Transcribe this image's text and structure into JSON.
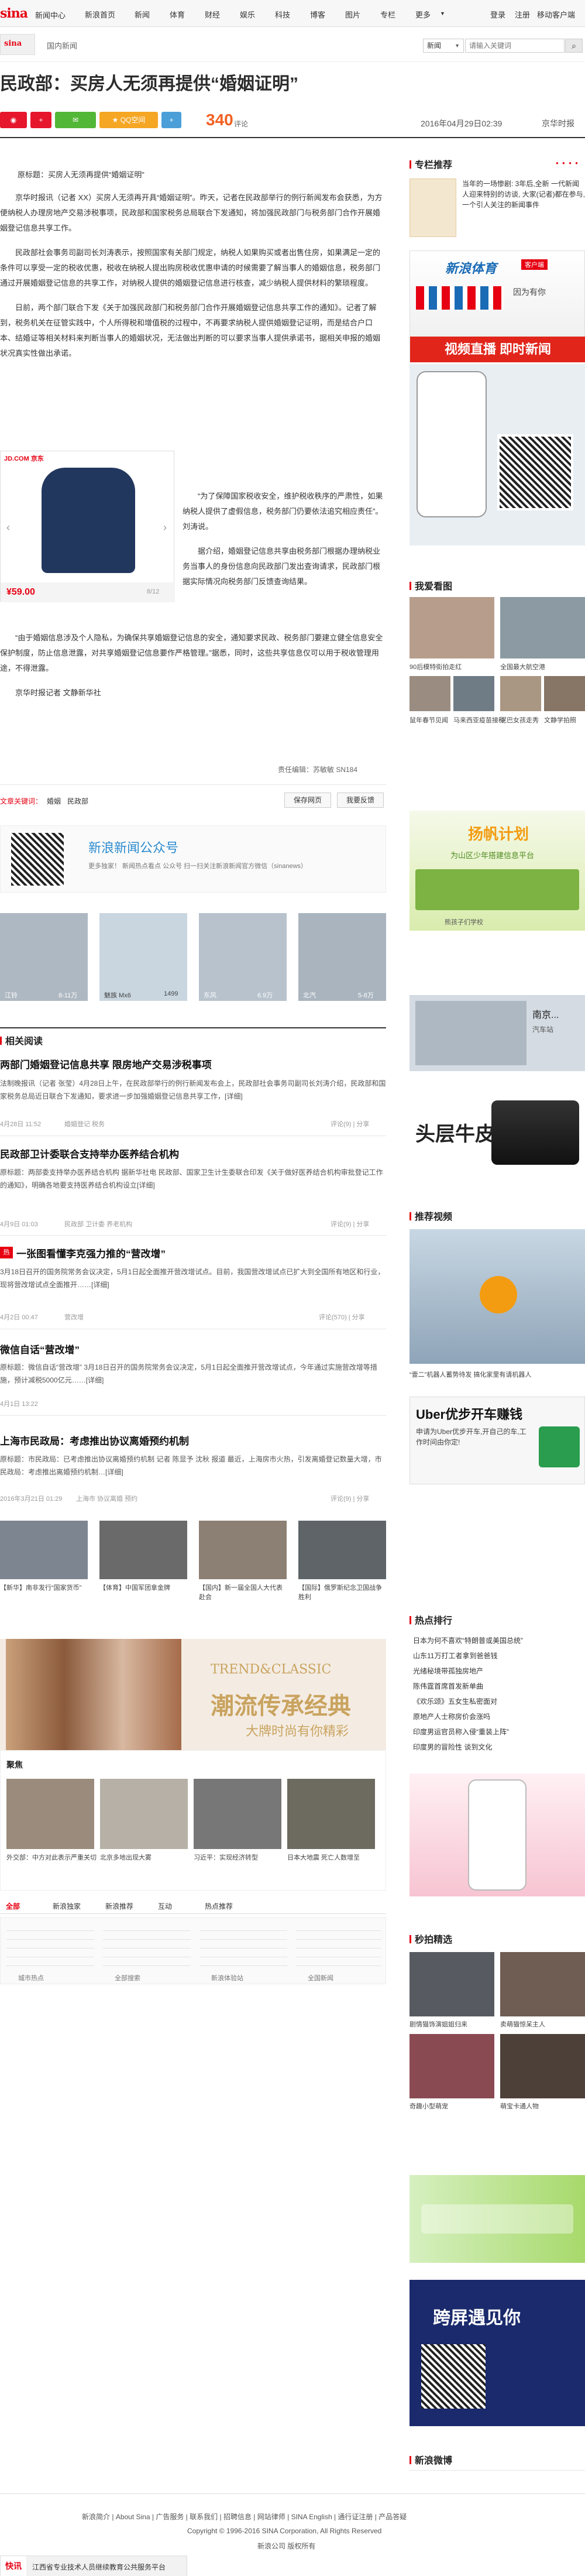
{
  "topnav": {
    "logo": "sina",
    "center": "新闻中心",
    "items": [
      "新浪首页",
      "新闻",
      "体育",
      "财经",
      "娱乐",
      "科技",
      "博客",
      "图片",
      "专栏",
      "更多"
    ],
    "login": "登录",
    "register": "注册",
    "mobile": "移动客户端"
  },
  "subnav": {
    "crumb": "国内新闻",
    "search_select": "新闻",
    "search_placeholder": "请输入关键词"
  },
  "article": {
    "title": "民政部：买房人无须再提供“婚姻证明”",
    "comments_count": "340",
    "comments_label": "评论",
    "datetime": "2016年04月29日02:39",
    "source": "京华时报",
    "share_weibo": "",
    "share_weixin": "",
    "share_qzone": "QQ空间",
    "orig_title": "原标题：买房人无须再提供“婚姻证明”",
    "paragraphs": [
      "京华时报讯（记者 XX）买房人无须再开具“婚姻证明”。昨天，记者在民政部举行的例行新闻发布会获悉，为方便纳税人办理房地产交易涉税事项，民政部和国家税务总局联合下发通知，将加强民政部门与税务部门合作开展婚姻登记信息共享工作。",
      "民政部社会事务司副司长刘涛表示，按照国家有关部门规定，纳税人如果购买或者出售住房，如果满足一定的条件可以享受一定的税收优惠，税收在纳税人提出购房税收优惠申请的时候需要了解当事人的婚姻信息，税务部门通过开展婚姻登记信息的共享工作，对纳税人提供的婚姻登记信息进行核查，减少纳税人提供材料的繁琐程度。",
      "日前，两个部门联合下发《关于加强民政部门和税务部门合作开展婚姻登记信息共享工作的通知》。记者了解到，税务机关在征管实践中，个人所得税和增值税的过程中，不再要求纳税人提供婚姻登记证明，而是结合户口本、结婚证等相关材料来判断当事人的婚姻状况，无法做出判断的可以要求当事人提供承诺书，据相关申报的婚姻状况真实性做出承诺。",
      "“为了保障国家税收安全，维护税收秩序的严肃性，如果纳税人提供了虚假信息，税务部门仍要依法追究相应责任”。刘涛说。",
      "据介绍，婚姻登记信息共享由税务部门根据办理纳税业务当事人的身份信息向民政部门发出查询请求，民政部门根据实际情况向税务部门反馈查询结果。",
      "“由于婚姻信息涉及个人隐私，为确保共享婚姻登记信息的安全，通知要求民政、税务部门要建立健全信息安全保护制度，防止信息泄露，对共享婚姻登记信息要作严格管理。”据悉，同时，这些共享信息仅可以用于税收管理用途，不得泄露。",
      "京华时报记者 文静新华社"
    ],
    "editor": "责任编辑：苏敏敏 SN184",
    "keywords_label": "文章关键词：",
    "keywords": [
      "婚姻",
      "民政部"
    ],
    "btn_save": "保存网页",
    "btn_report": "我要反馈"
  },
  "ad_shirt": {
    "brand": "JD.COM 京东",
    "price": "¥59.00",
    "page": "8/12"
  },
  "wechat": {
    "title": "新浪新闻公众号",
    "desc": "更多独家！ 新闻热点看点 公众号 扫一扫关注新浪新闻官方微信（sinanews）"
  },
  "cars": [
    {
      "label": "江铃",
      "price": "8-11万"
    },
    {
      "label": "魅族 Mx6",
      "price": "1499"
    },
    {
      "label": "东风",
      "price": "6.9万"
    },
    {
      "label": "北汽",
      "price": "5-8万"
    }
  ],
  "related": {
    "title": "相关阅读",
    "items": [
      {
        "title": "两部门婚姻登记信息共享 限房地产交易涉税事项",
        "text": "法制晚报讯（记者 张莹）4月28日上午，在民政部举行的例行新闻发布会上，民政部社会事务司副司长刘涛介绍，民政部和国家税务总局近日联合下发通知，要求进一步加强婚姻登记信息共享工作，[详细]",
        "date": "4月28日 11:52",
        "tags": "婚姻登记 税务",
        "ops": "评论(9) | 分享"
      },
      {
        "title": "民政部卫计委联合支持举办医养结合机构",
        "text": "原标题：两部委支持举办医养结合机构 据新华社电 民政部、国家卫生计生委联合印发《关于做好医养结合机构审批登记工作的通知》，明确各地要支持医养结合机构设立[详细]",
        "date": "4月9日 01:03",
        "tags": "民政部 卫计委 养老机构",
        "ops": "评论(9) | 分享"
      },
      {
        "title": "一张图看懂李克强力推的“营改增”",
        "text": "3月18日召开的国务院常务会议决定，5月1日起全面推开营改增试点。目前，我国营改增试点已扩大到全国所有地区和行业，现将营改增试点全面推开……[详细]",
        "date": "4月2日 00:47",
        "tags": "营改增",
        "ops": "评论(570) | 分享"
      },
      {
        "title": "微信自话“营改增”",
        "text": "原标题：微信自话“营改增” 3月18日召开的国务院常务会议决定，5月1日起全面推开营改增试点，今年通过实施营改增等措施，预计减税5000亿元……[详细]",
        "date": "4月1日 13:22",
        "tags": "",
        "ops": ""
      },
      {
        "title": "上海市民政局：考虑推出协议离婚预约机制",
        "text": "原标题：市民政局：已考虑推出协议离婚预约机制 记者 陈显予 沈秋 报道 最近，上海房市火热，引发离婚登记数量大增，市民政局：考虑推出离婚预约机制…[详细]",
        "date": "2016年3月21日 01:29",
        "tags": "上海市 协议离婚 预约",
        "ops": "评论(9) | 分享"
      }
    ]
  },
  "photos": [
    {
      "label": "【新华】南非发行“国家货币”",
      "img": "photo"
    },
    {
      "label": "【体育】中国军团拿金牌",
      "img": "photo"
    },
    {
      "label": "【国内】新一届全国人大代表赴会",
      "img": "photo"
    },
    {
      "label": "【国际】俄罗斯纪念卫国战争胜利",
      "img": "photo"
    }
  ],
  "banner": {
    "top": "TREND&CLASSIC",
    "main": "潮流传承经典",
    "sub": "大牌时尚有你精彩"
  },
  "focus": {
    "title": "聚焦",
    "items": [
      "外交部：中方对此表示严重关切",
      "北京多地出现大雾",
      "习近平：实现经济转型",
      "日本大地震 死亡人数增至"
    ],
    "tabs": [
      "全部",
      "新浪独家",
      "新浪推荐",
      "互动",
      "热点推荐"
    ]
  },
  "links_grid": [
    "城市热点",
    "全部搜索",
    "新浪体验站",
    "全国新闻"
  ],
  "sidebar": {
    "hot_title": "专栏推荐",
    "hot_text": "当年的一场惨剧: 3年后,全新 一代新闻人迎来特别的访谈, 大家(记者)都在参与,一个引人关注的新闻事件",
    "sports_title": "新浪体育",
    "sports_sub": "客户端",
    "sports_slogan": "因为有你",
    "video_live": "视频直播 即时新闻",
    "watch_title": "我爱看图",
    "watch_items": [
      "90后模特街拍走红",
      "全国最大航空港",
      "鼠年春节见闻",
      "马来西亚疫苗接种",
      "泥巴女孩走秀",
      "文静学拍照"
    ],
    "plan_title": "扬帆计划",
    "plan_sub": "为山区少年搭建信息平台",
    "plan_note": "熊孩子们学校",
    "car_city": "南京...",
    "car_sub": "汽车站",
    "top3": "头层牛皮",
    "video_title": "推荐视频",
    "video_caption": "“壹二”机器人蓄势待发 搞化家里有请机器人",
    "uber_title": "Uber优步开车赚钱",
    "uber_sub": "申请为Uber优步开车,开自己的车,工作时间由你定!",
    "hot2_title": "热点排行",
    "hot2_items": [
      "日本为何不喜欢“特朗普或美国总统”",
      "山东11万打工者拿到爸爸钱",
      "光绪秘境带孤独房地产",
      "陈伟霆首席首发新单曲",
      "《欢乐颂》五女生私密面对",
      "原地产人士称房价会涨吗",
      "印度男运官员称入侵“重装上阵”",
      "印度男的冒险性 谈到文化"
    ],
    "fresh_title": "秒拍精选",
    "fresh_items": [
      "剧情猫饰演姐姐归来",
      "卖萌猫惊呆主人",
      "奇趣小型萌宠",
      "萌宝卡通人物"
    ],
    "sina_app": "新浪新闻",
    "xb_title": "跨屏遇见你",
    "news_bottom": "新浪微博"
  },
  "footer": {
    "links": [
      "新浪简介",
      "About Sina",
      "广告服务",
      "联系我们",
      "招聘信息",
      "网站律师",
      "SINA English",
      "通行证注册",
      "产品答疑"
    ],
    "copyright": "Copyright © 1996-2016 SINA Corporation, All Rights Reserved",
    "company": "新浪公司 版权所有",
    "ticker_label": "快讯",
    "ticker_text": "江西省专业技术人员继续教育公共服务平台"
  }
}
